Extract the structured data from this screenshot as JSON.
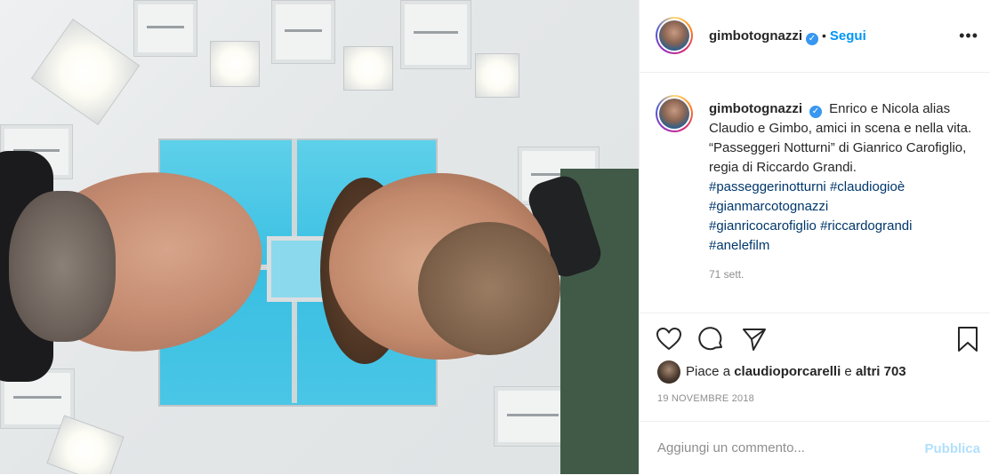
{
  "post": {
    "username": "gimbotognazzi",
    "verified_glyph": "✓",
    "separator": "•",
    "follow_label": "Segui",
    "more_label": "•••",
    "caption_text": "Enrico e Nicola alias Claudio e Gimbo, amici in scena e nella vita. “Passeggeri Notturni” di Gianrico Carofiglio, regia di Riccardo Grandi.",
    "hashtags": [
      "#passeggerinotturni",
      "#claudiogioè",
      "#gianmarcotognazzi",
      "#gianricocarofiglio",
      "#riccardograndi",
      "#anelefilm"
    ],
    "caption_age": "71 sett.",
    "likes_prefix": "Piace a ",
    "likes_user": "claudioporcarelli",
    "likes_middle": " e ",
    "likes_count": "altri 703",
    "date": "19 NOVEMBRE 2018",
    "comment_placeholder": "Aggiungi un commento...",
    "publish_label": "Pubblica"
  },
  "icons": {
    "like": "heart-icon",
    "comment": "comment-icon",
    "share": "share-icon",
    "save": "bookmark-icon",
    "more": "more-options-icon",
    "verified": "verified-badge-icon"
  },
  "colors": {
    "accent": "#0095f6",
    "hashtag": "#00376b",
    "muted": "#8e8e8e",
    "publish_disabled": "#b2dffc"
  }
}
